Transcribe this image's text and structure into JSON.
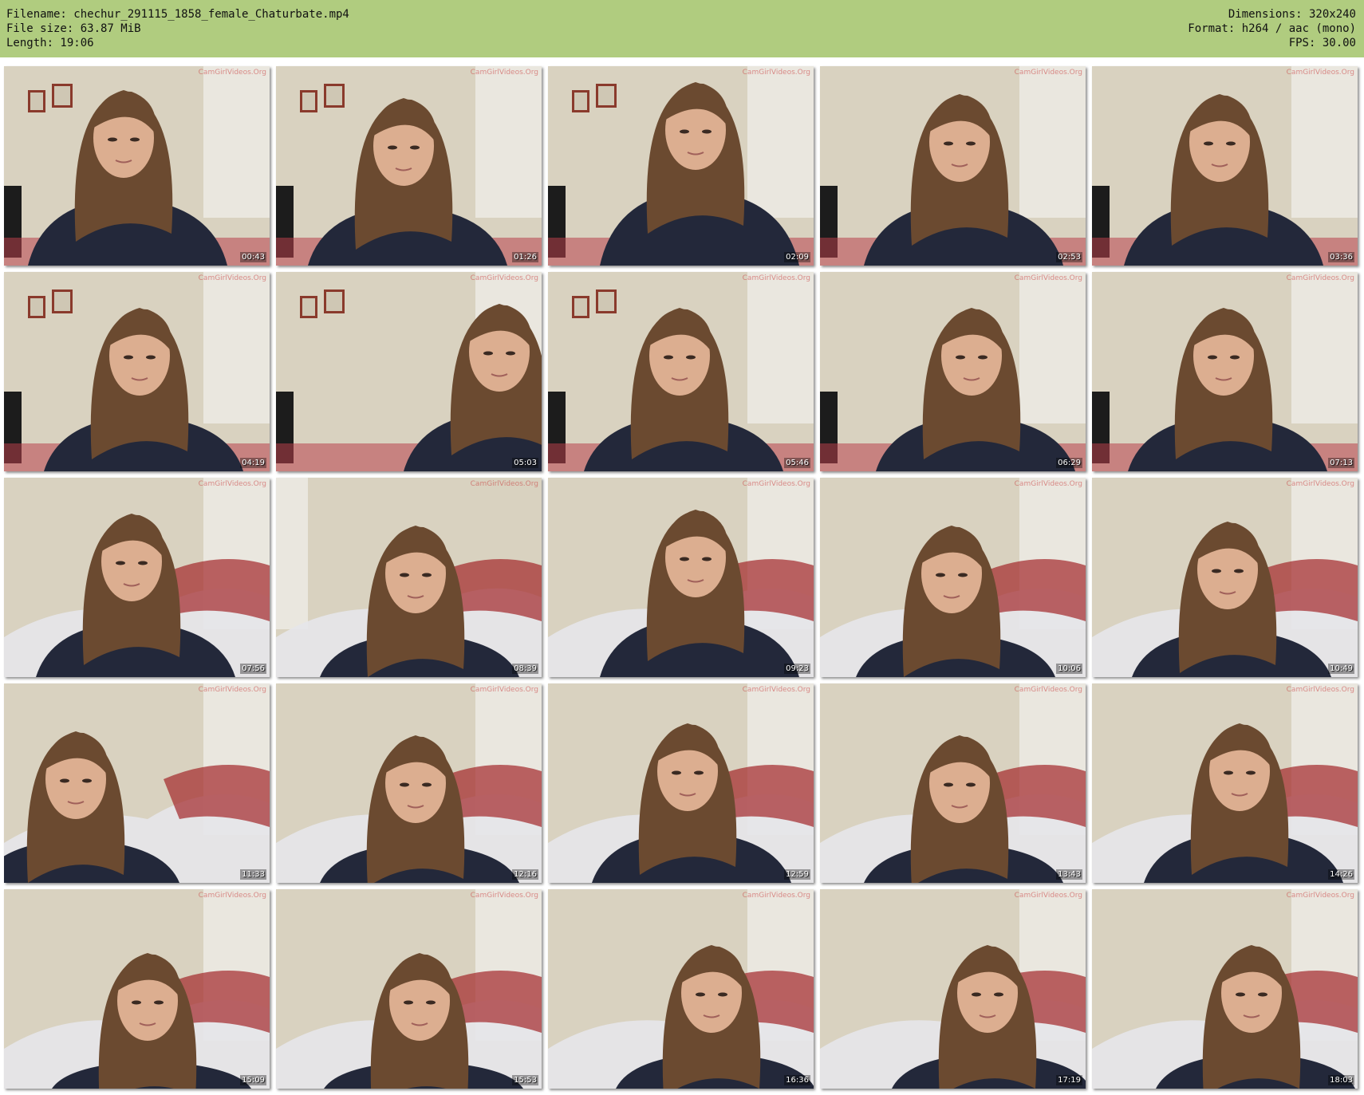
{
  "header": {
    "filename": "Filename: chechur_291115_1858_female_Chaturbate.mp4",
    "filesize": "File size: 63.87 MiB",
    "length": "Length: 19:06",
    "dimensions": "Dimensions: 320x240",
    "format": "Format: h264 / aac (mono)",
    "fps": "FPS: 30.00"
  },
  "watermark": "CamGirlVideos.Org",
  "thumbnails": [
    {
      "time": "00:43"
    },
    {
      "time": "01:26"
    },
    {
      "time": "02:09"
    },
    {
      "time": "02:53"
    },
    {
      "time": "03:36"
    },
    {
      "time": "04:19"
    },
    {
      "time": "05:03"
    },
    {
      "time": "05:46"
    },
    {
      "time": "06:29"
    },
    {
      "time": "07:13"
    },
    {
      "time": "07:56"
    },
    {
      "time": "08:39"
    },
    {
      "time": "09:23"
    },
    {
      "time": "10:06"
    },
    {
      "time": "10:49"
    },
    {
      "time": "11:33"
    },
    {
      "time": "12:16"
    },
    {
      "time": "12:59"
    },
    {
      "time": "13:43"
    },
    {
      "time": "14:26"
    },
    {
      "time": "15:09"
    },
    {
      "time": "15:53"
    },
    {
      "time": "16:36"
    },
    {
      "time": "17:19"
    },
    {
      "time": "18:03"
    }
  ],
  "colors": {
    "header_bg": "#b0cc7f",
    "wall": "#d9d2c0",
    "sweater": "#23283a",
    "hair": "#6b4a30",
    "skin": "#dcae90",
    "blanket": "#e6e6ea"
  }
}
